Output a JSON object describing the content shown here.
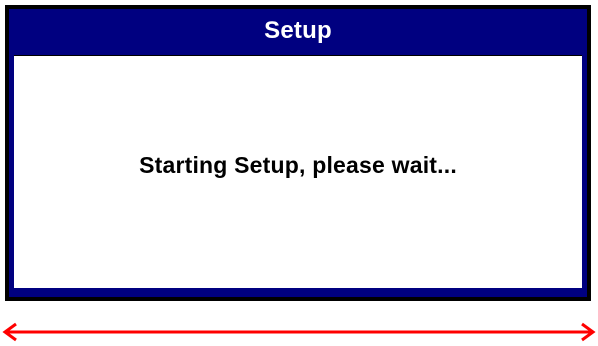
{
  "dialog": {
    "title": "Setup",
    "message": "Starting Setup, please wait..."
  },
  "colors": {
    "title_bar": "#000080",
    "title_text": "#ffffff",
    "content_bg": "#ffffff",
    "arrow": "#ff0000"
  },
  "icons": {
    "width_arrow": "double-headed-arrow-icon"
  }
}
